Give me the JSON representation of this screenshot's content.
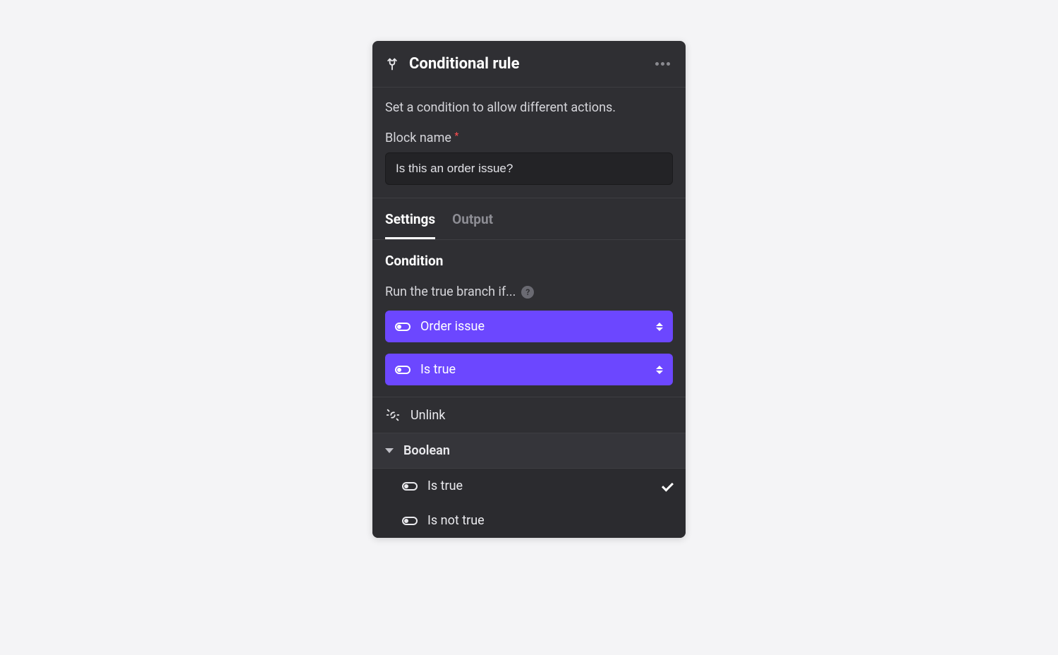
{
  "header": {
    "title": "Conditional rule"
  },
  "intro": {
    "description": "Set a condition to allow different actions.",
    "block_name_label": "Block name",
    "block_name_value": "Is this an order issue?"
  },
  "tabs": {
    "settings": "Settings",
    "output": "Output",
    "active": "settings"
  },
  "condition": {
    "title": "Condition",
    "run_label": "Run the true branch if...",
    "selects": [
      {
        "label": "Order issue"
      },
      {
        "label": "Is true"
      }
    ]
  },
  "dropdown": {
    "unlink_label": "Unlink",
    "group_label": "Boolean",
    "options": [
      {
        "label": "Is true",
        "selected": true
      },
      {
        "label": "Is not true",
        "selected": false
      }
    ]
  }
}
